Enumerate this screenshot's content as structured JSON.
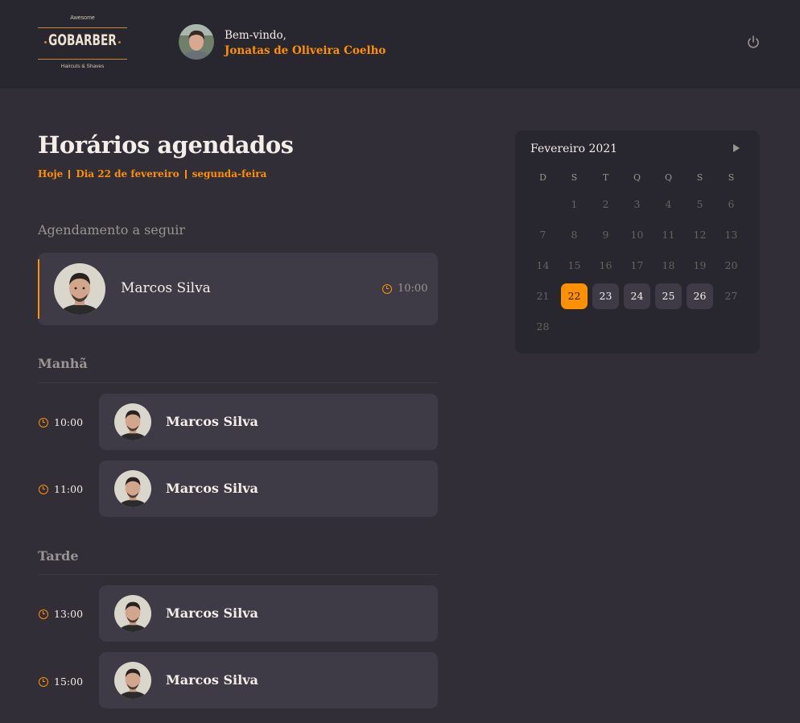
{
  "header": {
    "logo": {
      "top": "Awesome",
      "name": "GOBARBER",
      "bottom": "Haircuts & Shaves"
    },
    "welcome": "Bem-vindo,",
    "user_name": "Jonatas de Oliveira Coelho",
    "power_icon": "power-icon"
  },
  "main": {
    "title": "Horários agendados",
    "subtitle": {
      "today": "Hoje",
      "day": "Dia 22 de fevereiro",
      "weekday": "segunda-feira"
    },
    "next": {
      "heading": "Agendamento a seguir",
      "name": "Marcos Silva",
      "time": "10:00"
    },
    "sections": [
      {
        "title": "Manhã",
        "appointments": [
          {
            "time": "10:00",
            "name": "Marcos Silva"
          },
          {
            "time": "11:00",
            "name": "Marcos Silva"
          }
        ]
      },
      {
        "title": "Tarde",
        "appointments": [
          {
            "time": "13:00",
            "name": "Marcos Silva"
          },
          {
            "time": "15:00",
            "name": "Marcos Silva"
          }
        ]
      }
    ]
  },
  "calendar": {
    "month": "Fevereiro 2021",
    "weekdays": [
      "D",
      "S",
      "T",
      "Q",
      "Q",
      "S",
      "S"
    ],
    "days": [
      "1",
      "2",
      "3",
      "4",
      "5",
      "6",
      "7",
      "8",
      "9",
      "10",
      "11",
      "12",
      "13",
      "14",
      "15",
      "16",
      "17",
      "18",
      "19",
      "20",
      "21",
      "22",
      "23",
      "24",
      "25",
      "26",
      "27",
      "28"
    ],
    "first_weekday": 1,
    "selected": "22",
    "available": [
      "23",
      "24",
      "25",
      "26"
    ]
  },
  "colors": {
    "accent": "#ff9000",
    "background": "#312e38",
    "header": "#28262e",
    "card": "#3e3b47",
    "muted": "#999591",
    "text": "#f4ede8"
  }
}
